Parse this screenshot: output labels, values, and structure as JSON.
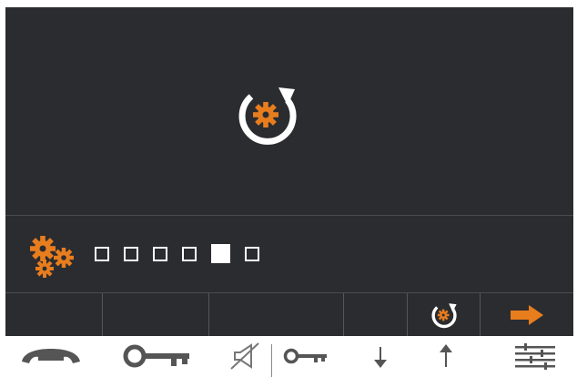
{
  "theme": {
    "screen_bg": "#2b2c30",
    "accent": "#e87d1e",
    "icon_white": "#ffffff",
    "hardware_gray": "#555555"
  },
  "main": {
    "center_icon": "settings-refresh-icon"
  },
  "status": {
    "settings_icon": "gears-icon",
    "step_count": 6,
    "active_step": 5
  },
  "softkeys": [
    {
      "name": "softkey-1",
      "icon": ""
    },
    {
      "name": "softkey-2",
      "icon": ""
    },
    {
      "name": "softkey-3",
      "icon": ""
    },
    {
      "name": "softkey-4",
      "icon": ""
    },
    {
      "name": "softkey-5",
      "icon": ""
    },
    {
      "name": "softkey-6",
      "icon": "settings-refresh-icon"
    },
    {
      "name": "softkey-7",
      "icon": "arrow-right-icon"
    }
  ],
  "hardware_buttons": [
    {
      "name": "handset-button",
      "icon": "handset-icon"
    },
    {
      "name": "key-button",
      "icon": "key-icon"
    },
    {
      "name": "mute-button",
      "icon": "speaker-mute-icon"
    },
    {
      "name": "secondary-key-button",
      "icon": "key-small-icon"
    },
    {
      "name": "down-button",
      "icon": "arrow-down-icon"
    },
    {
      "name": "up-button",
      "icon": "arrow-up-icon"
    },
    {
      "name": "menu-button",
      "icon": "sliders-icon"
    }
  ]
}
